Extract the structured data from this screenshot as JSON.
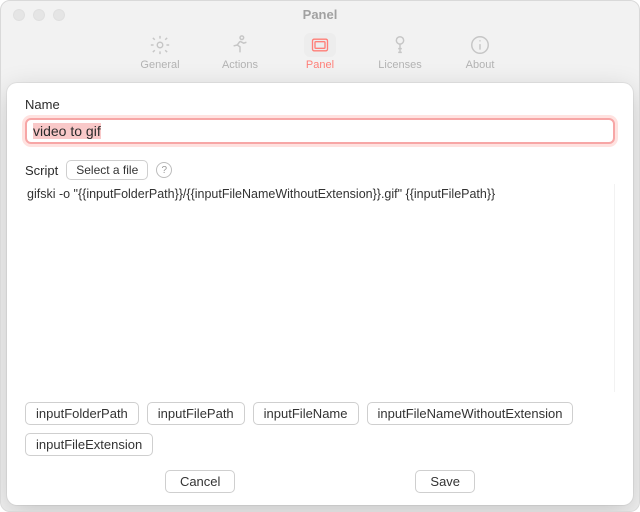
{
  "window": {
    "title": "Panel"
  },
  "toolbar": {
    "items": [
      {
        "label": "General",
        "icon": "gear-icon"
      },
      {
        "label": "Actions",
        "icon": "running-icon"
      },
      {
        "label": "Panel",
        "icon": "panel-icon",
        "active": true
      },
      {
        "label": "Licenses",
        "icon": "key-icon"
      },
      {
        "label": "About",
        "icon": "info-icon"
      }
    ]
  },
  "form": {
    "name_label": "Name",
    "name_value": "video to gif",
    "script_label": "Script",
    "select_file_label": "Select a file",
    "help_symbol": "?",
    "script_text": "gifski -o \"{{inputFolderPath}}/{{inputFileNameWithoutExtension}}.gif\" {{inputFilePath}}"
  },
  "variables": [
    "inputFolderPath",
    "inputFilePath",
    "inputFileName",
    "inputFileNameWithoutExtension",
    "inputFileExtension"
  ],
  "buttons": {
    "cancel": "Cancel",
    "save": "Save"
  }
}
